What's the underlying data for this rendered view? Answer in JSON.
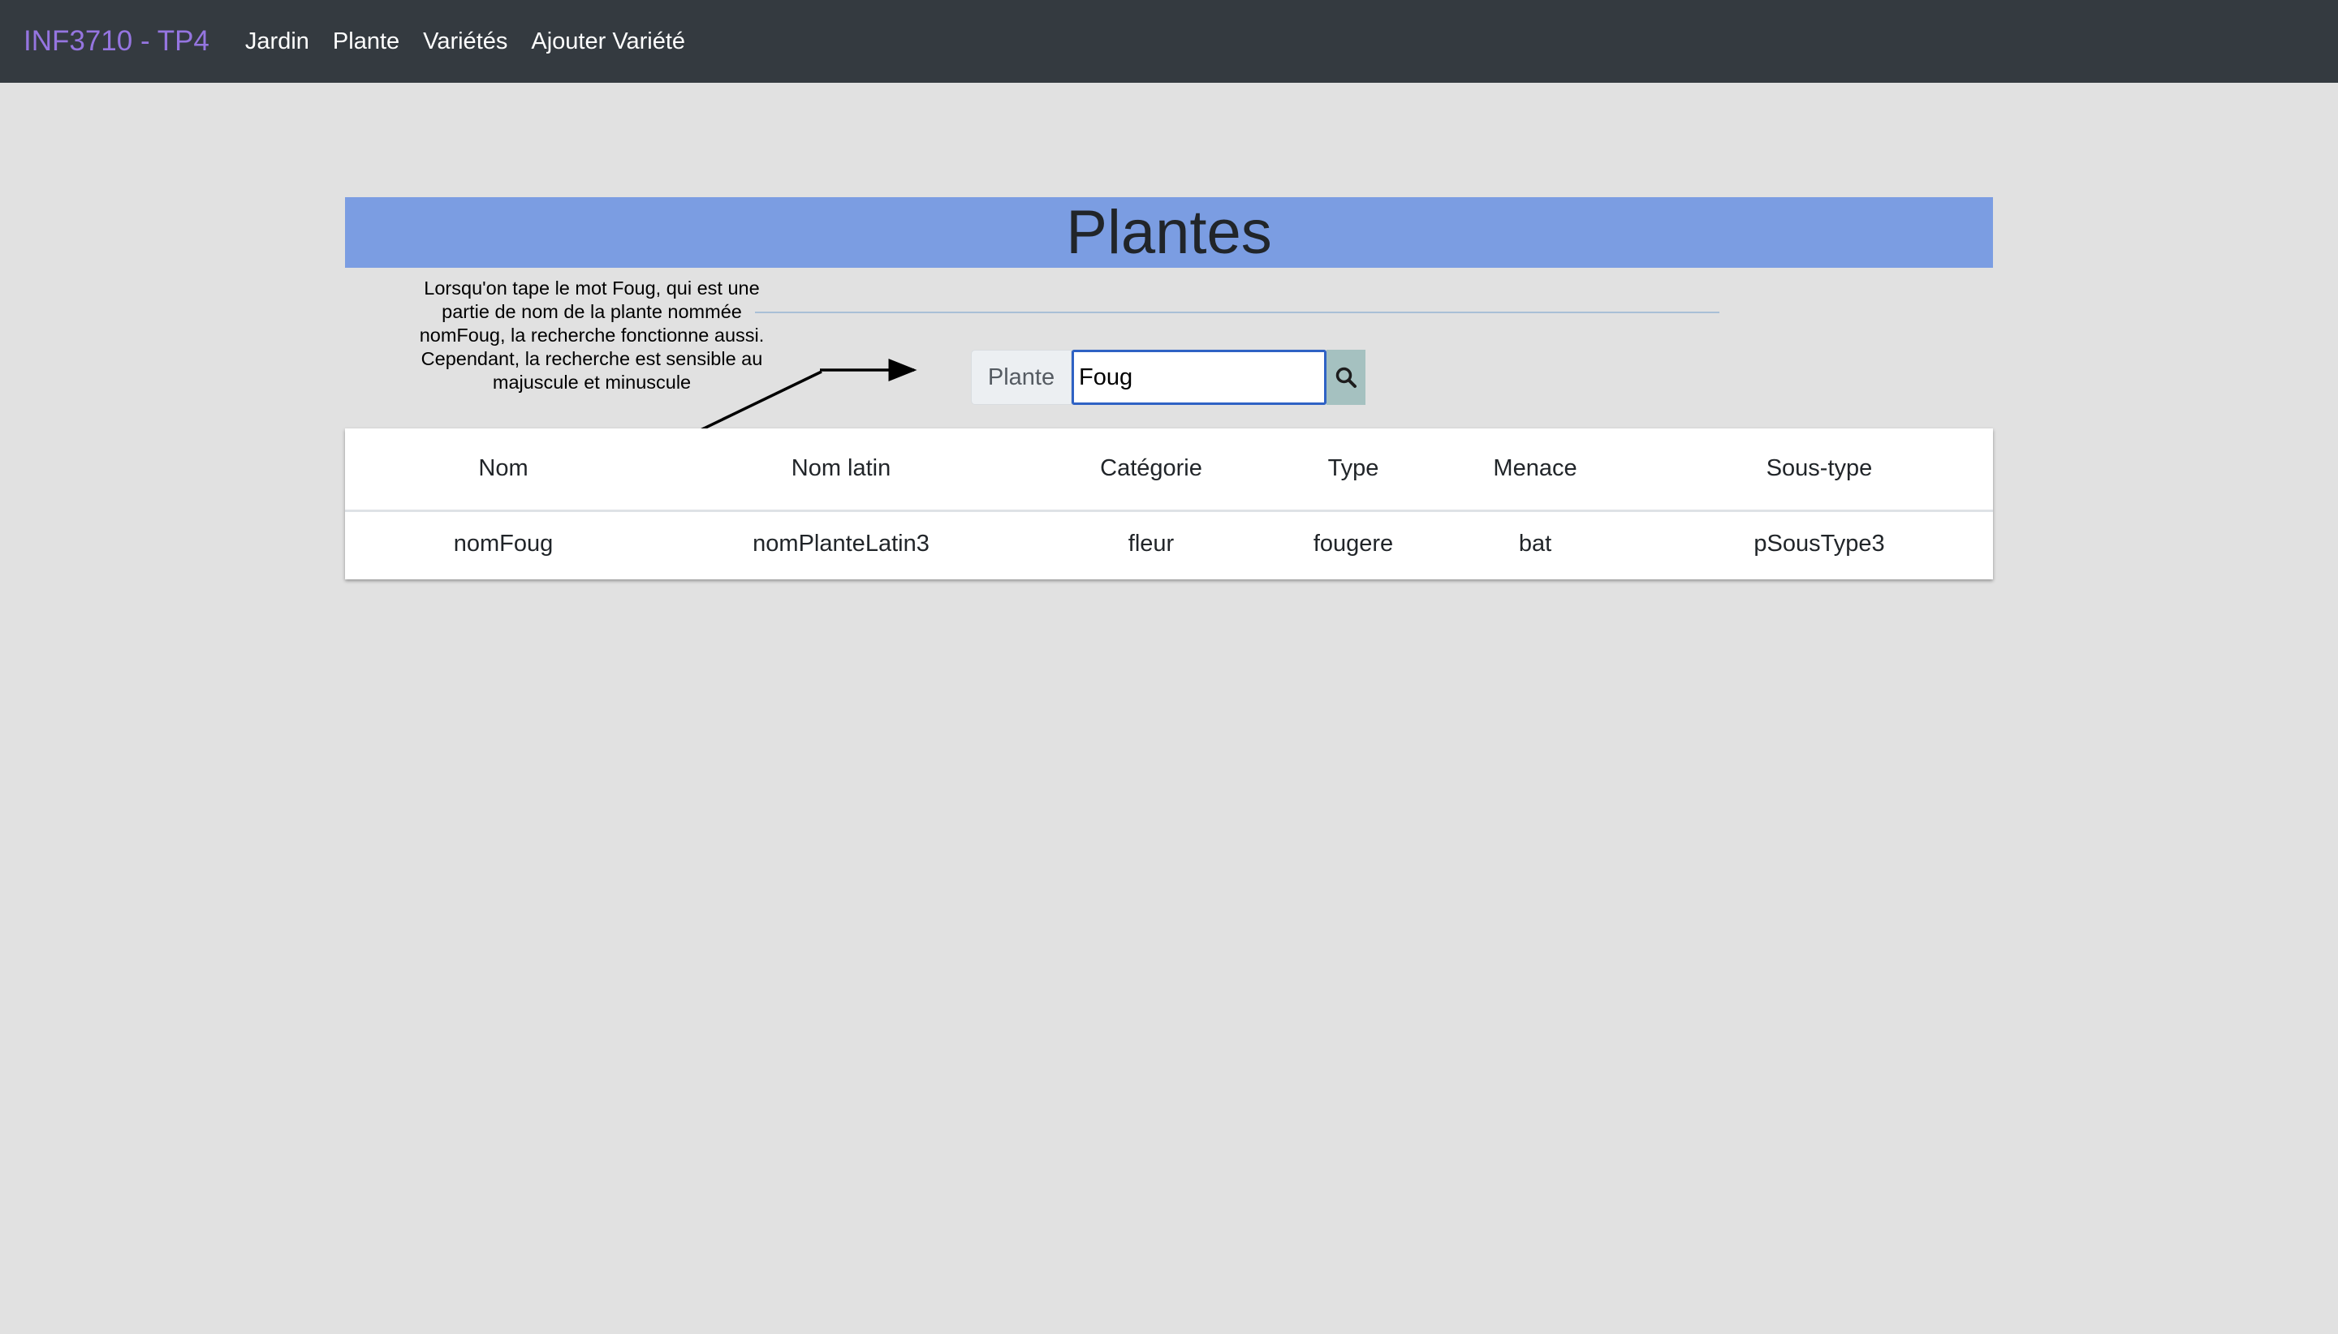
{
  "navbar": {
    "brand": "INF3710 - TP4",
    "links": [
      "Jardin",
      "Plante",
      "Variétés",
      "Ajouter Variété"
    ]
  },
  "page": {
    "title": "Plantes"
  },
  "annotation": {
    "text": "Lorsqu'on tape le mot Foug, qui est une partie de nom de la plante nommée nomFoug, la recherche fonctionne aussi. Cependant, la recherche est sensible au majuscule et minuscule"
  },
  "search": {
    "label": "Plante",
    "value": "Foug",
    "button_icon": "search-icon"
  },
  "table": {
    "headers": [
      "Nom",
      "Nom latin",
      "Catégorie",
      "Type",
      "Menace",
      "Sous-type"
    ],
    "rows": [
      [
        "nomFoug",
        "nomPlanteLatin3",
        "fleur",
        "fougere",
        "bat",
        "pSousType3"
      ]
    ]
  },
  "colors": {
    "navbar": "#343a40",
    "brand": "#9575e0",
    "title_bar": "#7b9de2",
    "page_bg": "#e1e1e1",
    "search_button": "#a5c1c0",
    "input_border": "#2f62c4"
  }
}
